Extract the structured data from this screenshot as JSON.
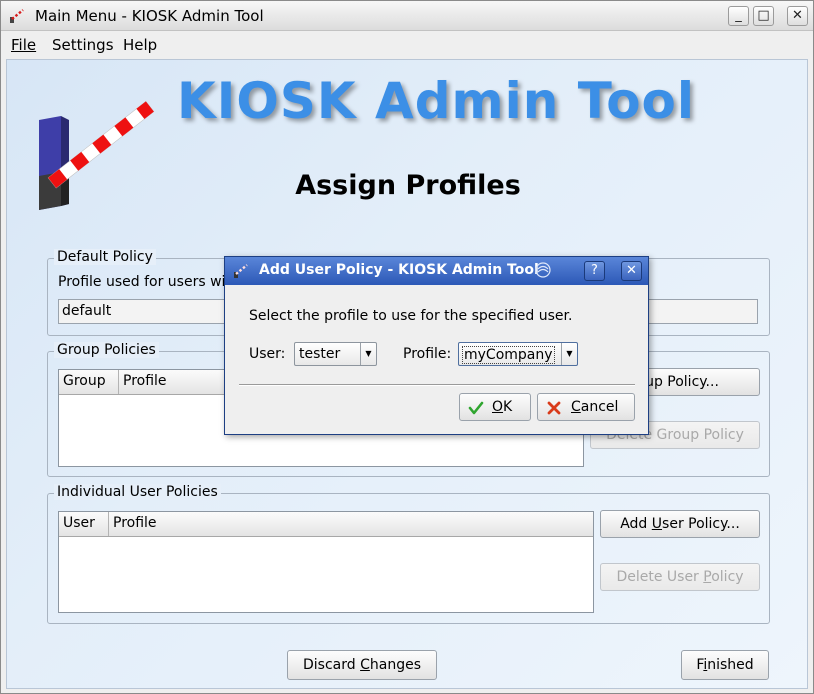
{
  "window": {
    "title": "Main Menu - KIOSK Admin Tool",
    "minimize": "_",
    "maximize": "□",
    "close": "✕"
  },
  "menu": {
    "file": "File",
    "settings": "Settings",
    "help": "Help"
  },
  "banner": "KIOSK Admin Tool",
  "heading": "Assign Profiles",
  "default_policy": {
    "legend": "Default Policy",
    "description": "Profile used for users wit",
    "value": "default"
  },
  "group_policies": {
    "legend": "Group Policies",
    "columns": [
      "Group",
      "Profile"
    ],
    "add_button": "roup Policy...",
    "delete_button": "Delete Group Policy"
  },
  "user_policies": {
    "legend": "Individual User Policies",
    "columns": [
      "User",
      "Profile"
    ],
    "add_button_pre": "Add ",
    "add_button_u": "U",
    "add_button_post": "ser Policy...",
    "delete_button_pre": "Delete User ",
    "delete_button_u": "P",
    "delete_button_post": "olicy"
  },
  "footer": {
    "discard_pre": "Discard ",
    "discard_u": "C",
    "discard_post": "hanges",
    "finished_pre": "F",
    "finished_u": "i",
    "finished_post": "nished"
  },
  "dialog": {
    "title": "Add User Policy - KIOSK Admin Tool",
    "help": "?",
    "close": "✕",
    "instruction": "Select the profile to use for the specified user.",
    "user_label": "User:",
    "user_value": "tester",
    "profile_label": "Profile:",
    "profile_value": "myCompany",
    "ok_u": "O",
    "ok_post": "K",
    "cancel_u": "C",
    "cancel_post": "ancel"
  },
  "colors": {
    "banner": "#3c8fe6",
    "dialog_title": "#2c58b6",
    "ok_icon": "#2fa52f",
    "cancel_icon": "#d93b1a"
  }
}
